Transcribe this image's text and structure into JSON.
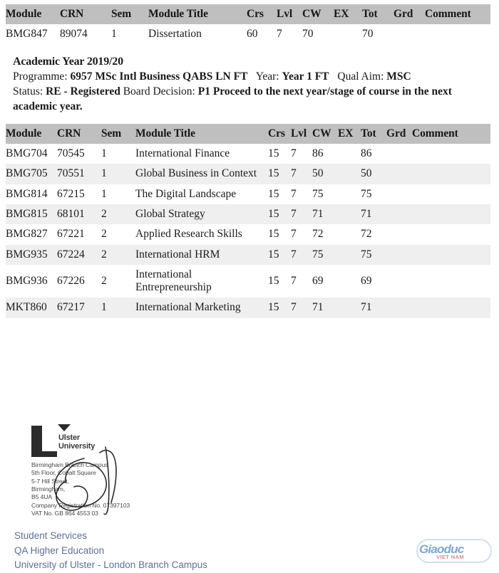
{
  "document": {
    "columns": [
      "Module",
      "CRN",
      "Sem",
      "Module Title",
      "Crs",
      "Lvl",
      "CW",
      "EX",
      "Tot",
      "Grd",
      "Comment"
    ],
    "top_table": {
      "rows": [
        {
          "module": "BMG847",
          "crn": "89074",
          "sem": "1",
          "title": "Dissertation",
          "crs": "60",
          "lvl": "7",
          "cw": "70",
          "ex": "",
          "tot": "70",
          "grd": "",
          "comment": ""
        }
      ]
    },
    "academic_year": {
      "heading": "Academic Year 2019/20",
      "programme_label": "Programme:",
      "programme_value": "6957 MSc Intl Business QABS LN FT",
      "year_label": "Year:",
      "year_value": "Year 1 FT",
      "qual_aim_label": "Qual Aim:",
      "qual_aim_value": "MSC",
      "status_label": "Status:",
      "status_value": "RE - Registered",
      "board_decision_label": "Board Decision:",
      "board_decision_value": "P1 Proceed to the next year/stage of course in the next academic year."
    },
    "main_table": {
      "rows": [
        {
          "module": "BMG704",
          "crn": "70545",
          "sem": "1",
          "title": "International Finance",
          "crs": "15",
          "lvl": "7",
          "cw": "86",
          "ex": "",
          "tot": "86",
          "grd": "",
          "comment": ""
        },
        {
          "module": "BMG705",
          "crn": "70551",
          "sem": "1",
          "title": "Global Business in Context",
          "crs": "15",
          "lvl": "7",
          "cw": "50",
          "ex": "",
          "tot": "50",
          "grd": "",
          "comment": ""
        },
        {
          "module": "BMG814",
          "crn": "67215",
          "sem": "1",
          "title": "The Digital Landscape",
          "crs": "15",
          "lvl": "7",
          "cw": "75",
          "ex": "",
          "tot": "75",
          "grd": "",
          "comment": ""
        },
        {
          "module": "BMG815",
          "crn": "68101",
          "sem": "2",
          "title": "Global Strategy",
          "crs": "15",
          "lvl": "7",
          "cw": "71",
          "ex": "",
          "tot": "71",
          "grd": "",
          "comment": ""
        },
        {
          "module": "BMG827",
          "crn": "67221",
          "sem": "2",
          "title": "Applied Research Skills",
          "crs": "15",
          "lvl": "7",
          "cw": "72",
          "ex": "",
          "tot": "72",
          "grd": "",
          "comment": ""
        },
        {
          "module": "BMG935",
          "crn": "67224",
          "sem": "2",
          "title": "International HRM",
          "crs": "15",
          "lvl": "7",
          "cw": "75",
          "ex": "",
          "tot": "75",
          "grd": "",
          "comment": ""
        },
        {
          "module": "BMG936",
          "crn": "67226",
          "sem": "2",
          "title": "International Entrepreneurship",
          "crs": "15",
          "lvl": "7",
          "cw": "69",
          "ex": "",
          "tot": "69",
          "grd": "",
          "comment": ""
        },
        {
          "module": "MKT860",
          "crn": "67217",
          "sem": "1",
          "title": "International Marketing",
          "crs": "15",
          "lvl": "7",
          "cw": "71",
          "ex": "",
          "tot": "71",
          "grd": "",
          "comment": ""
        }
      ]
    }
  },
  "letterhead": {
    "institution_line1": "Ulster",
    "institution_line2": "University",
    "address": [
      "Birmingham Branch Campus",
      "5th Floor, Cobalt Square",
      "5-7 Hill Street,",
      "Birmingham,",
      "B5 4UA",
      "Company Registration No. 07397103",
      "VAT No. GB 864 4553 03"
    ]
  },
  "footer": {
    "lines": [
      "Student Services",
      "QA Higher Education",
      "University of Ulster - London Branch Campus"
    ],
    "link_color": "#5d7198"
  },
  "watermark": {
    "brand": "Giaoduc",
    "subtitle": "VIET NAM",
    "brand_color": "#7ba7d4",
    "subtitle_color": "#d98a8a"
  },
  "theme": {
    "header_band": "#bfbfbf",
    "stripe": "#efefef",
    "text": "#1a1a1a"
  }
}
